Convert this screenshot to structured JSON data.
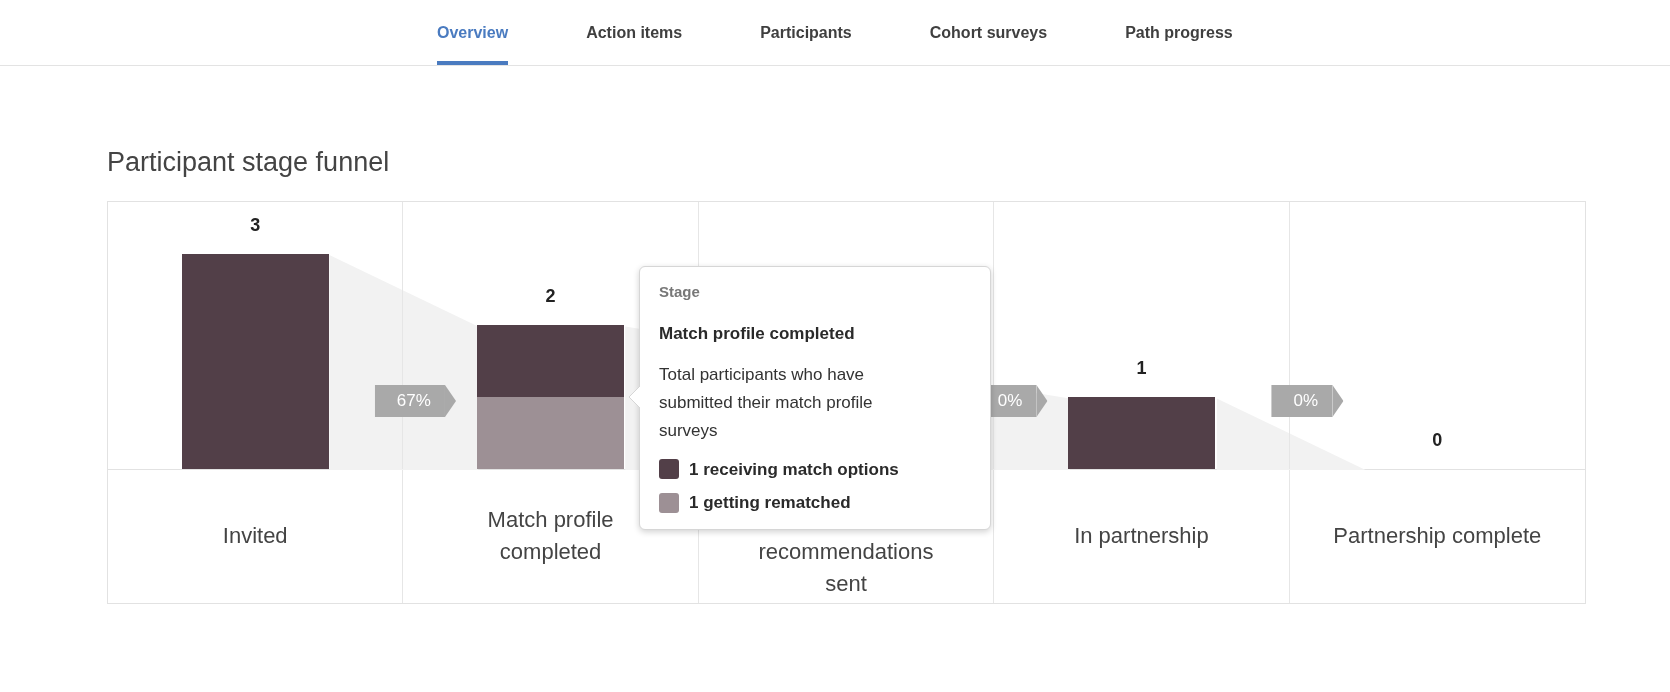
{
  "tabs": [
    {
      "label": "Overview",
      "selected": true
    },
    {
      "label": "Action items",
      "selected": false
    },
    {
      "label": "Participants",
      "selected": false
    },
    {
      "label": "Cohort surveys",
      "selected": false
    },
    {
      "label": "Path progress",
      "selected": false
    }
  ],
  "title": "Participant stage funnel",
  "stages": [
    {
      "count": "3",
      "label": "Invited",
      "segments": [
        {
          "color": "#523f48",
          "level": 1
        }
      ],
      "conversion": "67%"
    },
    {
      "count": "2",
      "label": "Match profile completed",
      "segments": [
        {
          "color": "#523f48",
          "level": 0.667
        },
        {
          "color": "#9d9095",
          "level": 0.333
        }
      ]
    },
    {
      "label": "recommendations sent",
      "conversion": "0%"
    },
    {
      "count": "1",
      "label": "In partnership",
      "segments": [
        {
          "color": "#523f48",
          "level": 0.333
        }
      ],
      "conversion": "0%"
    },
    {
      "count": "0",
      "label": "Partnership complete"
    }
  ],
  "tooltip": {
    "heading": "Stage",
    "title": "Match profile completed",
    "description": "Total participants who have submitted their match profile surveys",
    "legend": [
      {
        "label": "1 receiving match options",
        "color": "#523f48"
      },
      {
        "label": "1 getting rematched",
        "color": "#9d9095"
      }
    ]
  }
}
